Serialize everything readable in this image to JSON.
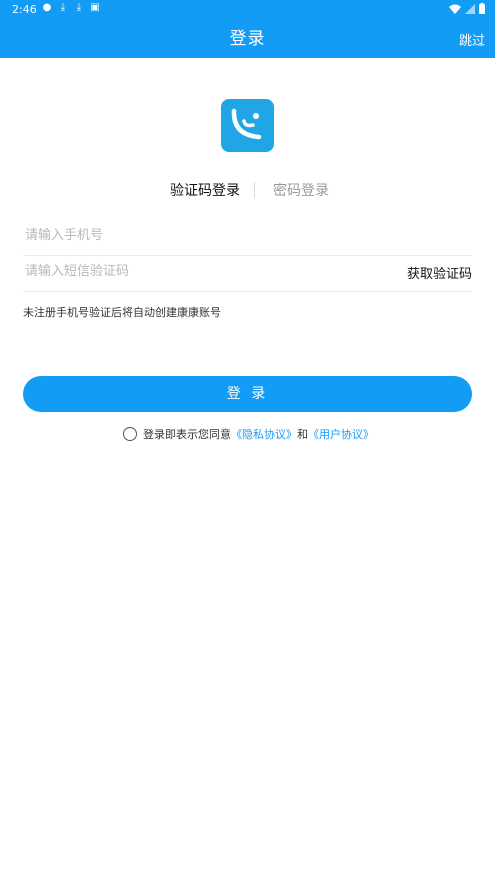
{
  "status": {
    "time": "2:46"
  },
  "header": {
    "title": "登录",
    "skip": "跳过"
  },
  "tabs": {
    "active": "验证码登录",
    "inactive": "密码登录"
  },
  "form": {
    "phone_placeholder": "请输入手机号",
    "code_placeholder": "请输入短信验证码",
    "get_code": "获取验证码",
    "hint": "未注册手机号验证后将自动创建康康账号"
  },
  "login_button": "登 录",
  "agreement": {
    "prefix": "登录即表示您同意",
    "privacy": "《隐私协议》",
    "and": "和",
    "user": "《用户协议》"
  },
  "colors": {
    "accent": "#129cf5",
    "logo": "#20a6e6"
  }
}
